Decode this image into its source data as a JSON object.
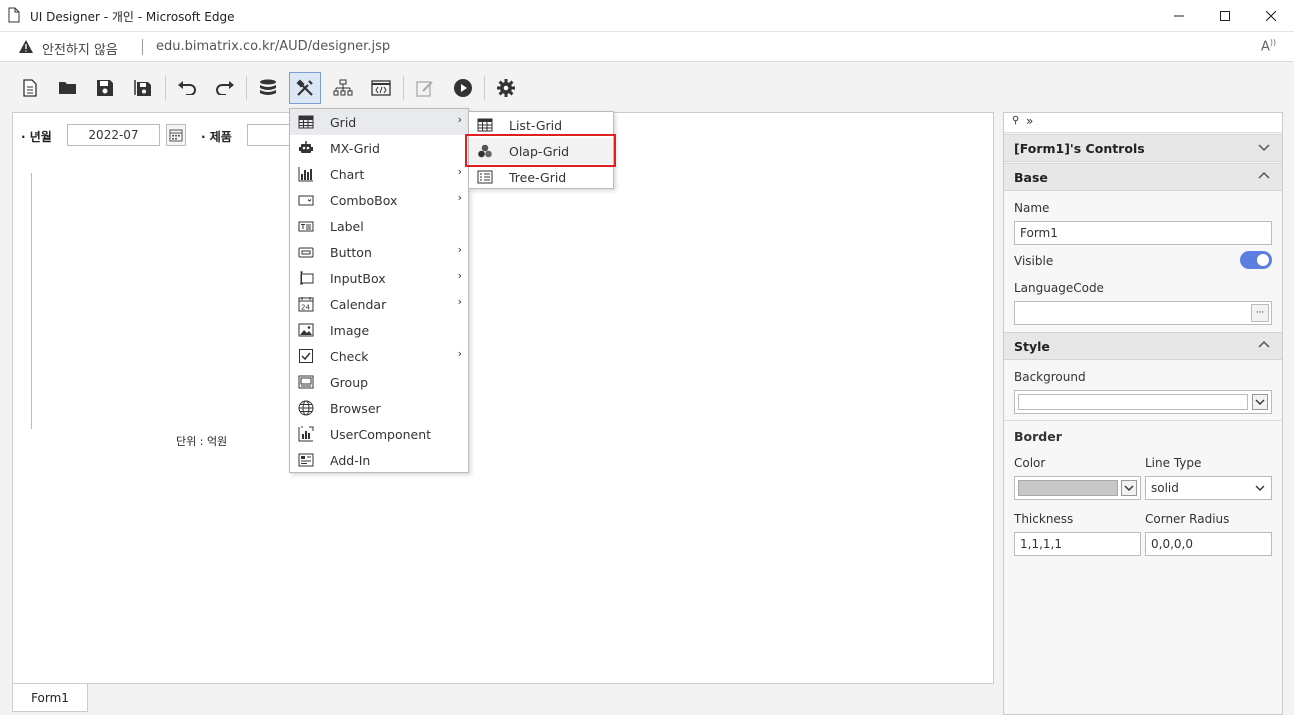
{
  "window": {
    "title": "UI Designer - 개인 - Microsoft Edge",
    "minimize_icon": "minimize-icon",
    "maximize_icon": "maximize-icon",
    "close_icon": "close-icon"
  },
  "addressbar": {
    "security_text": "안전하지 않음",
    "url": "edu.bimatrix.co.kr/AUD/designer.jsp"
  },
  "toolbar": {
    "icons": [
      "new-document-icon",
      "open-folder-icon",
      "save-icon",
      "save-all-icon",
      "undo-icon",
      "redo-icon",
      "database-icon",
      "tools-icon",
      "hierarchy-icon",
      "script-icon",
      "edit-icon",
      "run-icon",
      "settings-icon"
    ],
    "active": "tools-icon"
  },
  "form": {
    "period_label": "· 년월",
    "period_value": "2022-07",
    "product_label": "· 제품",
    "product_value": "",
    "unit_text": "단위 : 억원",
    "tab_label": "Form1"
  },
  "menu": {
    "items": [
      {
        "label": "Grid",
        "icon": "grid-icon",
        "submenu": true
      },
      {
        "label": "MX-Grid",
        "icon": "mx-grid-icon",
        "submenu": false
      },
      {
        "label": "Chart",
        "icon": "chart-icon",
        "submenu": true
      },
      {
        "label": "ComboBox",
        "icon": "combobox-icon",
        "submenu": true
      },
      {
        "label": "Label",
        "icon": "label-icon",
        "submenu": false
      },
      {
        "label": "Button",
        "icon": "button-icon",
        "submenu": true
      },
      {
        "label": "InputBox",
        "icon": "inputbox-icon",
        "submenu": true
      },
      {
        "label": "Calendar",
        "icon": "calendar-icon",
        "submenu": true
      },
      {
        "label": "Image",
        "icon": "image-icon",
        "submenu": false
      },
      {
        "label": "Check",
        "icon": "check-icon",
        "submenu": true
      },
      {
        "label": "Group",
        "icon": "group-icon",
        "submenu": false
      },
      {
        "label": "Browser",
        "icon": "globe-icon",
        "submenu": false
      },
      {
        "label": "UserComponent",
        "icon": "user-component-icon",
        "submenu": false
      },
      {
        "label": "Add-In",
        "icon": "add-in-icon",
        "submenu": false
      }
    ],
    "submenu": [
      {
        "label": "List-Grid",
        "icon": "list-grid-icon"
      },
      {
        "label": "Olap-Grid",
        "icon": "olap-grid-icon"
      },
      {
        "label": "Tree-Grid",
        "icon": "tree-grid-icon"
      }
    ],
    "highlighted_sub": "Olap-Grid"
  },
  "panel": {
    "header": "[Form1]'s Controls",
    "base_title": "Base",
    "name_label": "Name",
    "name_value": "Form1",
    "visible_label": "Visible",
    "visible_on": true,
    "language_label": "LanguageCode",
    "language_value": "",
    "more_button": "···",
    "style_title": "Style",
    "background_label": "Background",
    "background_value": "",
    "border_title": "Border",
    "color_label": "Color",
    "linetype_label": "Line Type",
    "linetype_value": "solid",
    "thickness_label": "Thickness",
    "thickness_value": "1,1,1,1",
    "radius_label": "Corner Radius",
    "radius_value": "0,0,0,0"
  },
  "colors": {
    "accent": "#5b7fe0",
    "highlight_border": "#e02020",
    "active_tool_bg": "#dde7f4"
  }
}
